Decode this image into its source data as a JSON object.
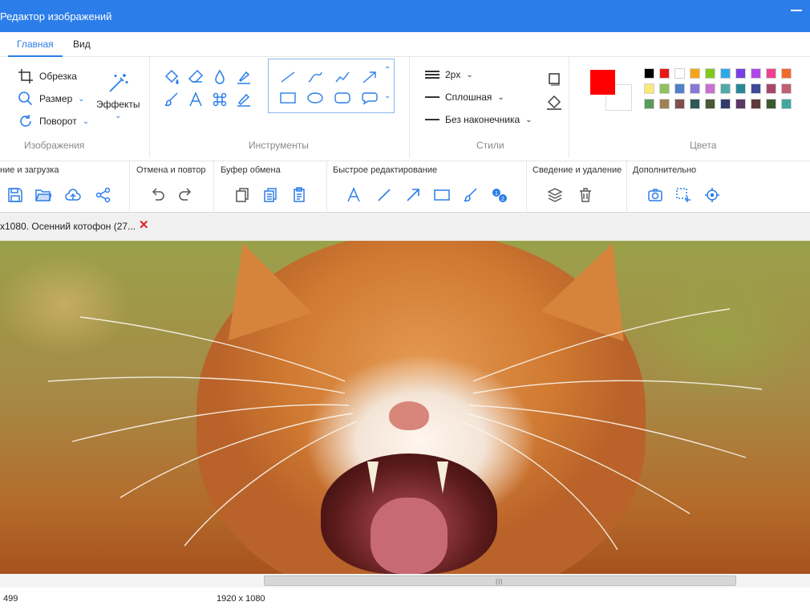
{
  "window": {
    "title": "Редактор изображений"
  },
  "menu": {
    "tabs": [
      "Главная",
      "Вид"
    ],
    "active": "Главная"
  },
  "ribbon": {
    "images_group": {
      "label": "Изображения",
      "crop": "Обрезка",
      "resize": "Размер",
      "rotate": "Поворот",
      "effects": "Эффекты"
    },
    "tools_group": {
      "label": "Инструменты"
    },
    "styles_group": {
      "label": "Стили",
      "stroke_width": "2px",
      "line_style": "Сплошная",
      "line_end": "Без наконечника"
    },
    "colors_group": {
      "label": "Цвета",
      "primary_color": "#ff0000",
      "secondary_color": "#ffffff",
      "palette": [
        "#000000",
        "#e81818",
        "#ffffff",
        "#f4a418",
        "#80c820",
        "#2fa8e8",
        "#7840e0",
        "#b048e8",
        "#f04090",
        "#f06a2a",
        "#f8e878",
        "#90c060",
        "#5080c8",
        "#8878d8",
        "#c870d0",
        "#50a8a8",
        "#288898",
        "#404898",
        "#a84868",
        "#c06070",
        "#5a9a5a",
        "#a08058",
        "#805050",
        "#305858",
        "#485838",
        "#303a6a",
        "#5a3868",
        "#603838",
        "#3a5a2a",
        "#40a8a0"
      ]
    }
  },
  "quickbar": {
    "sections": [
      {
        "label": "ние и загрузка"
      },
      {
        "label": "Отмена и повтор"
      },
      {
        "label": "Буфер обмена"
      },
      {
        "label": "Быстрое редактирование"
      },
      {
        "label": "Сведение и удаление"
      },
      {
        "label": "Дополнительно"
      }
    ]
  },
  "document_tab": {
    "label": "x1080. Осенний котофон (27...",
    "close": "✕"
  },
  "statusbar": {
    "position": "499",
    "dimensions": "1920 x 1080"
  }
}
